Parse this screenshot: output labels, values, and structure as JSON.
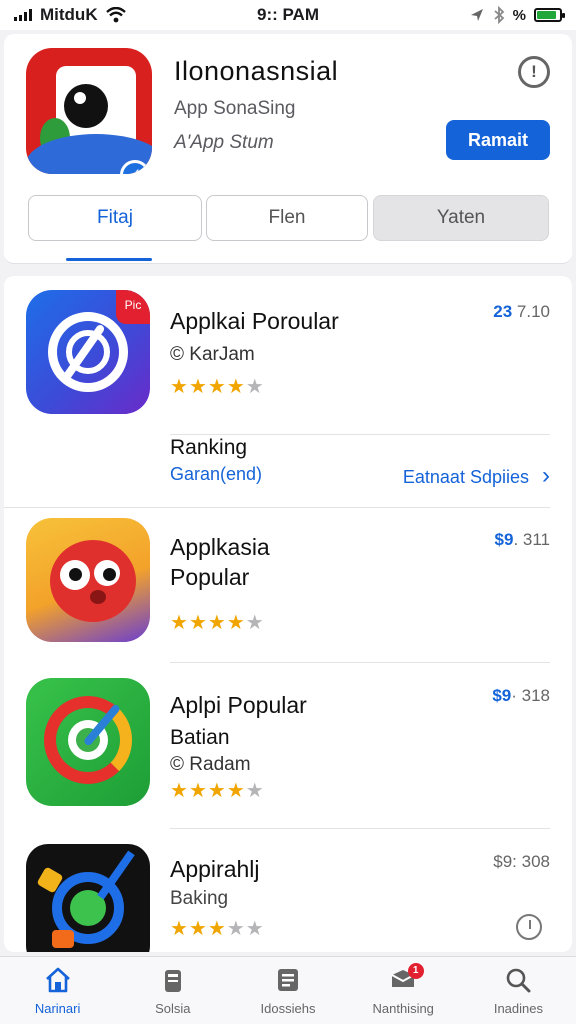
{
  "status_bar": {
    "carrier": "MitduK",
    "time": "9:: PAM",
    "right_text": "%",
    "icons": [
      "signal-icon",
      "wifi-icon",
      "location-icon",
      "bluetooth-icon",
      "battery-icon"
    ],
    "battery_level": 0.85
  },
  "header": {
    "app_title": "Ilononasnsial",
    "subtitle": "App  SonaSing",
    "subtitle2": "A'App Stum",
    "primary_button": "Ramait",
    "segments": [
      "Fitaj",
      "Flen",
      "Yaten"
    ],
    "active_segment": 0
  },
  "apps": [
    {
      "name": "Applkai Poroular",
      "developer": "© KarJam",
      "price_value": "23",
      "price_rest": " 7.10",
      "rating": 3.5,
      "corner_badge": "Pic"
    },
    {
      "name_line1": "Applkasia",
      "name_line2": "Popular",
      "price_value": "$9",
      "price_rest": ". 311",
      "rating": 3.5
    },
    {
      "name": "Aplpi Popular",
      "subtitle": "Batian",
      "developer": "© Radam",
      "price_value": "$9",
      "price_rest": "· 318",
      "rating": 3.5
    },
    {
      "name": "Appirahlj",
      "subtitle": "Baking",
      "price_text": "$9: 308",
      "rating": 3
    }
  ],
  "ranking": {
    "title": "Ranking",
    "link": "Garan(end)",
    "right_link": "Eatnaat Sdpiies",
    "chevron": "›"
  },
  "star_glyph": "★",
  "tabs": [
    {
      "label": "Narinari",
      "icon": "home-icon"
    },
    {
      "label": "Solsia",
      "icon": "apps-icon"
    },
    {
      "label": "Idossiehs",
      "icon": "list-icon"
    },
    {
      "label": "Nanthising",
      "icon": "updates-icon",
      "badge": "1"
    },
    {
      "label": "Inadines",
      "icon": "search-icon"
    }
  ],
  "colors": {
    "accent": "#1463d8",
    "star": "#f0a500",
    "battery": "#22a83a"
  }
}
